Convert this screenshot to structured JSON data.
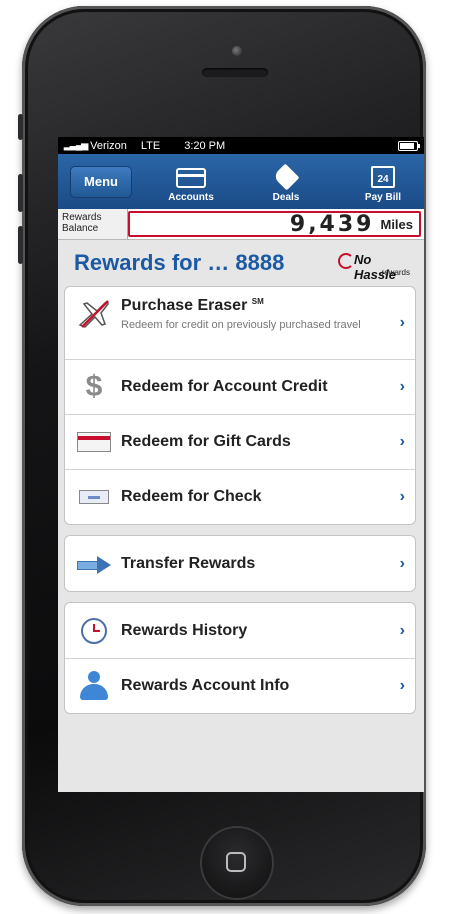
{
  "status_bar": {
    "carrier": "Verizon",
    "network": "LTE",
    "time": "3:20 PM"
  },
  "nav": {
    "menu_label": "Menu",
    "items": [
      {
        "label": "Accounts",
        "icon": "accounts-icon"
      },
      {
        "label": "Deals",
        "icon": "tag-icon"
      },
      {
        "label": "Pay Bill",
        "icon": "calendar-icon",
        "icon_text": "24"
      }
    ]
  },
  "balance": {
    "label_line1": "Rewards",
    "label_line2": "Balance",
    "value": "9,439",
    "unit": "Miles"
  },
  "header": {
    "title": "Rewards for … 8888",
    "logo_main": "No Hassle",
    "logo_sub": "rewards"
  },
  "redeem_options": [
    {
      "label": "Purchase Eraser",
      "label_mark": "SM",
      "subtitle": "Redeem for credit on previously purchased travel",
      "icon": "airplane-icon"
    },
    {
      "label": "Redeem for Account Credit",
      "icon": "dollar-icon"
    },
    {
      "label": "Redeem for Gift Cards",
      "icon": "gift-card-icon"
    },
    {
      "label": "Redeem for Check",
      "icon": "check-icon"
    }
  ],
  "transfer": {
    "label": "Transfer Rewards",
    "icon": "arrow-right-icon"
  },
  "account_options": [
    {
      "label": "Rewards History",
      "icon": "history-clock-icon"
    },
    {
      "label": "Rewards Account Info",
      "icon": "person-icon"
    }
  ],
  "chevron_glyph": "›"
}
